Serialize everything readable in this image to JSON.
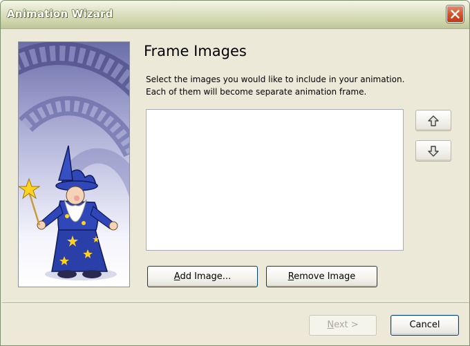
{
  "window": {
    "title": "Animation Wizard"
  },
  "page": {
    "heading": "Frame Images",
    "description_line1": "Select the images you would like to include in your animation.",
    "description_line2": "Each of them will become separate animation frame."
  },
  "image_list": {
    "items": []
  },
  "buttons": {
    "move_up": "up-arrow-icon",
    "move_down": "down-arrow-icon",
    "add_image_accel": "A",
    "add_image_rest": "dd Image...",
    "remove_image_accel": "R",
    "remove_image_rest": "emove Image",
    "next_accel": "N",
    "next_rest": "ext >",
    "cancel": "Cancel"
  },
  "states": {
    "next_enabled": false
  },
  "colors": {
    "titlebar": "#cfd5ab",
    "face": "#ece9d8",
    "close": "#d0502a",
    "banner": "#8d8fc2"
  }
}
